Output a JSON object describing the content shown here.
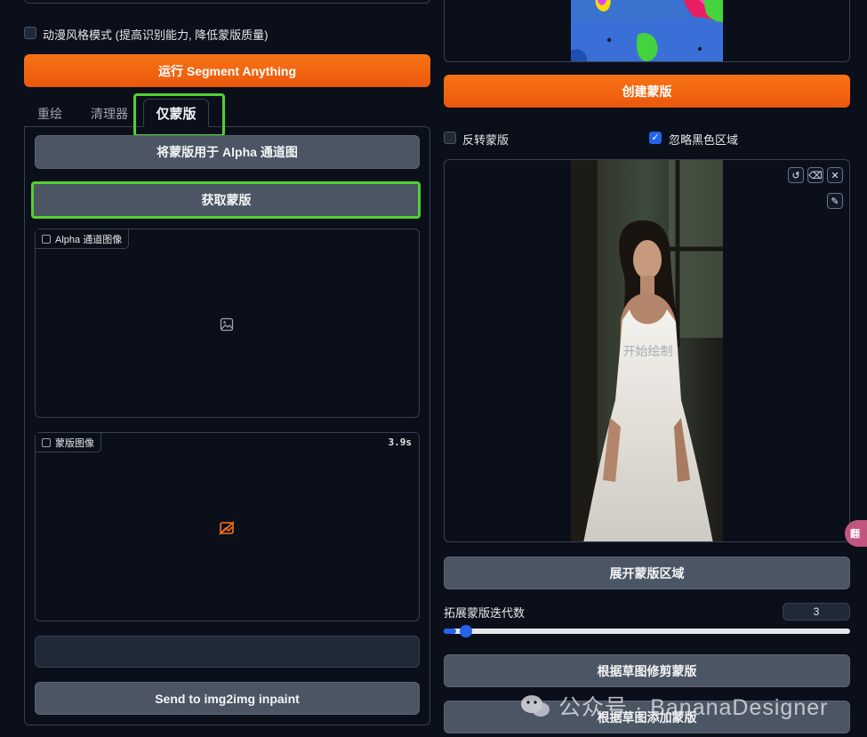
{
  "left": {
    "anime_checkbox_label": "动漫风格模式 (提高识别能力, 降低蒙版质量)",
    "run_button": "运行 Segment Anything",
    "tabs": [
      {
        "label": "重绘"
      },
      {
        "label": "清理器"
      },
      {
        "label": "仅蒙版"
      }
    ],
    "apply_alpha_button": "将蒙版用于 Alpha 通道图",
    "get_mask_button": "获取蒙版",
    "alpha_panel_label": "Alpha 通道图像",
    "mask_panel_label": "蒙版图像",
    "mask_panel_time": "3.9s",
    "send_button": "Send to img2img inpaint"
  },
  "right": {
    "create_mask_button": "创建蒙版",
    "invert_label": "反转蒙版",
    "ignore_black_label": "忽略黑色区域",
    "canvas_overlay_text": "开始绘制",
    "expand_button": "展开蒙版区域",
    "iterations_label": "拓展蒙版迭代数",
    "iterations_value": "3",
    "slider_value": 3,
    "trim_button": "根据草图修剪蒙版",
    "add_button": "根据草图添加蒙版",
    "side_badge": "翻"
  },
  "watermark": "公众号 · BananaDesigner",
  "colors": {
    "accent_orange": "#f97316",
    "highlight_green": "#52d12f",
    "bg": "#0b0f19",
    "checkbox_blue": "#2563eb"
  }
}
